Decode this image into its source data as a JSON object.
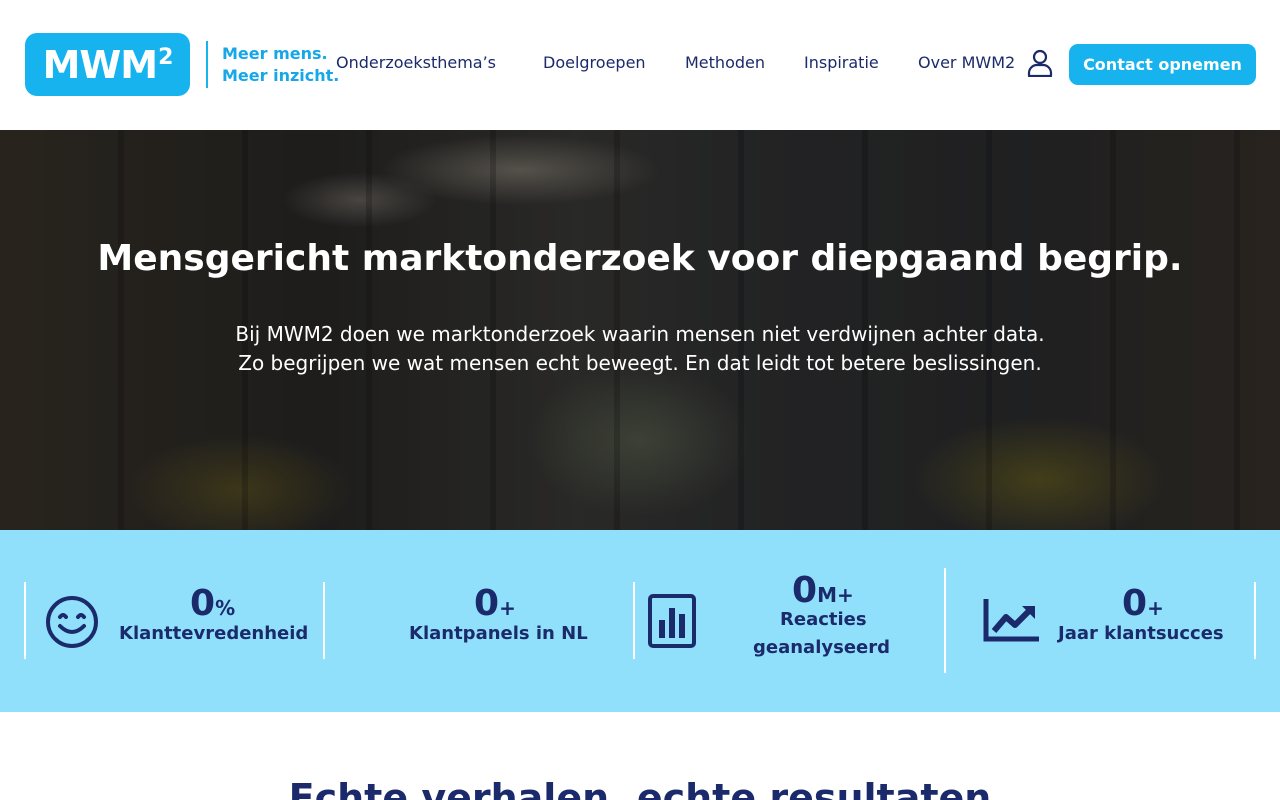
{
  "header": {
    "logo": {
      "text": "MWM",
      "superscript": "2"
    },
    "tagline": {
      "line1": "Meer mens.",
      "line2": "Meer inzicht."
    },
    "nav": [
      {
        "label": "Onderzoeksthema’s"
      },
      {
        "label": "Doelgroepen"
      },
      {
        "label": "Methoden"
      },
      {
        "label": "Inspiratie"
      },
      {
        "label": "Over MWM2"
      }
    ],
    "account_icon": "user-icon",
    "cta_label": "Contact opnemen"
  },
  "hero": {
    "title": "Mensgericht marktonderzoek voor diepgaand begrip.",
    "subtitle_line1": "Bij MWM2 doen we marktonderzoek waarin mensen niet verdwijnen achter data.",
    "subtitle_line2": "Zo begrijpen we wat mensen echt beweegt. En dat leidt tot betere beslissingen."
  },
  "stats": [
    {
      "value": "0",
      "suffix": "%",
      "label": "Klanttevredenheid",
      "icon": "smiley-icon"
    },
    {
      "value": "0",
      "suffix": "+",
      "label": "Klantpanels in NL",
      "icon": ""
    },
    {
      "value": "0",
      "suffix": "M+",
      "label_line1": "Reacties",
      "label_line2": "geanalyseerd",
      "icon": "bar-chart-icon"
    },
    {
      "value": "0",
      "suffix": "+",
      "label": "Jaar klantsucces",
      "icon": "trend-up-icon"
    }
  ],
  "section_heading": "Echte verhalen, echte resultaten",
  "colors": {
    "brand_blue": "#16b3ef",
    "navy": "#1b2a6b",
    "stats_bg": "#90e0fb"
  }
}
